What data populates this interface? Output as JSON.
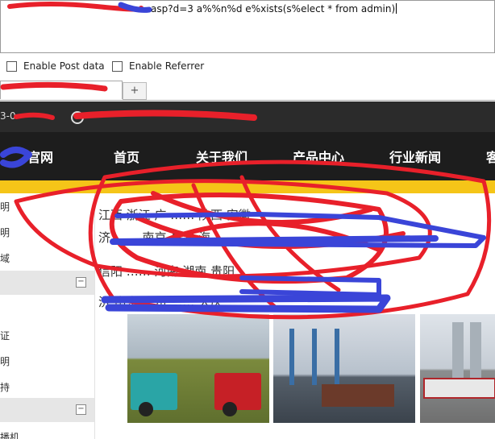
{
  "url_bar": {
    "visible_text": "asp?d=3 a%%n%d  e%xists(s%elect * from admin)"
  },
  "options": {
    "post_label": "Enable Post data",
    "referrer_label": "Enable Referrer"
  },
  "tabs": {
    "new_tab_symbol": "+"
  },
  "site": {
    "topbar_lead": "3-0",
    "logo_suffix": "官网",
    "nav": [
      "首页",
      "关于我们",
      "产品中心",
      "行业新闻",
      "客"
    ],
    "sidebar": {
      "rows_a": [
        "明",
        "明",
        "域"
      ],
      "rows_b": [
        "证",
        "明",
        "持"
      ],
      "row_c": "播机",
      "collapse_symbol": "−"
    },
    "content_lines": [
      "江西 浙江 广 …… 陕西 安徽",
      "济 …… 南京 昌北 海",
      "信阳 …… 河南 湖南 贵阳",
      "济 南京 广州 …… 大庆"
    ]
  },
  "colors": {
    "scribble_red": "#e8202a",
    "scribble_blue": "#3a45d8",
    "nav_bg": "#1d1d1d",
    "accent_yellow": "#f5c518"
  }
}
